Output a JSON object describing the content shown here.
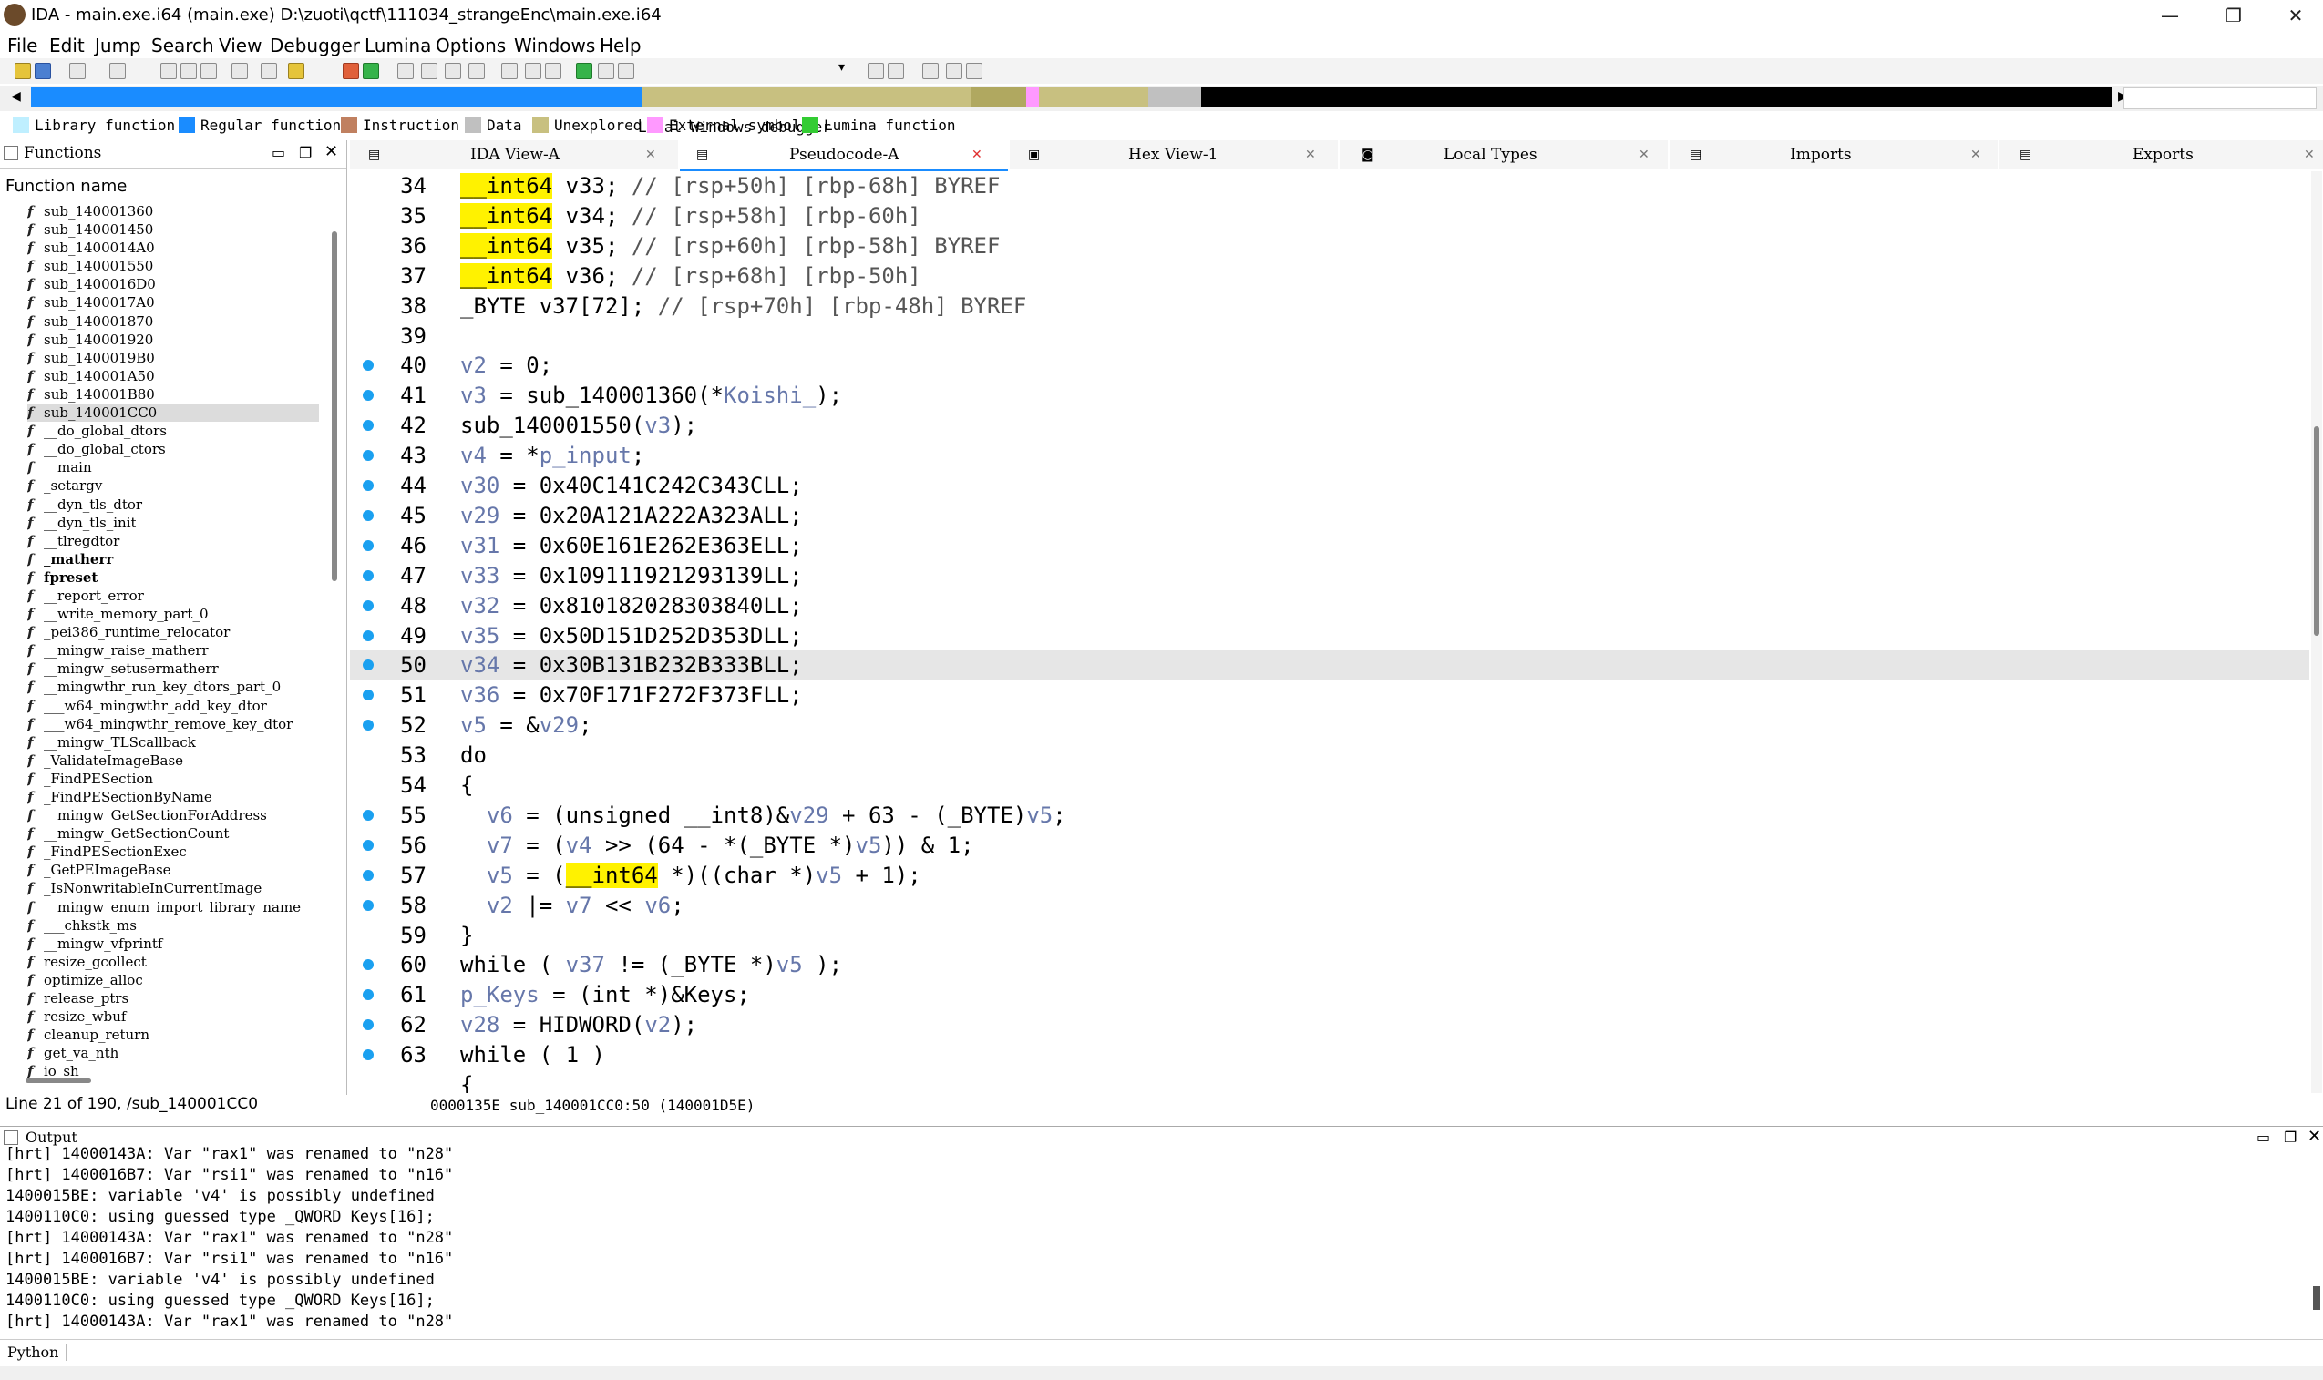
{
  "window": {
    "title": "IDA - main.exe.i64 (main.exe) D:\\zuoti\\qctf\\111034_strangeEnc\\main.exe.i64",
    "min": "—",
    "max": "❐",
    "close": "✕"
  },
  "menu": [
    "File",
    "Edit",
    "Jump",
    "Search",
    "View",
    "Debugger",
    "Lumina",
    "Options",
    "Windows",
    "Help"
  ],
  "toolbar": {
    "debugger": "Local Windows debugger"
  },
  "legend": [
    {
      "label": "Library function",
      "color": "#bfefff"
    },
    {
      "label": "Regular function",
      "color": "#1a8cff"
    },
    {
      "label": "Instruction",
      "color": "#c08060"
    },
    {
      "label": "Data",
      "color": "#c0c0c0"
    },
    {
      "label": "Unexplored",
      "color": "#c8c080"
    },
    {
      "label": "External symbol",
      "color": "#ff99ff"
    },
    {
      "label": "Lumina function",
      "color": "#33cc33"
    }
  ],
  "functions": {
    "panel_title": "Functions",
    "column_header": "Function name",
    "items": [
      "sub_140001360",
      "sub_140001450",
      "sub_1400014A0",
      "sub_140001550",
      "sub_1400016D0",
      "sub_1400017A0",
      "sub_140001870",
      "sub_140001920",
      "sub_1400019B0",
      "sub_140001A50",
      "sub_140001B80",
      "sub_140001CC0",
      "__do_global_dtors",
      "__do_global_ctors",
      "__main",
      "_setargv",
      "__dyn_tls_dtor",
      "__dyn_tls_init",
      "__tlregdtor",
      "_matherr",
      "fpreset",
      "__report_error",
      "__write_memory_part_0",
      "_pei386_runtime_relocator",
      "__mingw_raise_matherr",
      "__mingw_setusermatherr",
      "__mingwthr_run_key_dtors_part_0",
      "___w64_mingwthr_add_key_dtor",
      "___w64_mingwthr_remove_key_dtor",
      "__mingw_TLScallback",
      "_ValidateImageBase",
      "_FindPESection",
      "_FindPESectionByName",
      "__mingw_GetSectionForAddress",
      "__mingw_GetSectionCount",
      "_FindPESectionExec",
      "_GetPEImageBase",
      "_IsNonwritableInCurrentImage",
      "__mingw_enum_import_library_name",
      "___chkstk_ms",
      "__mingw_vfprintf",
      "resize_gcollect",
      "optimize_alloc",
      "release_ptrs",
      "resize_wbuf",
      "cleanup_return",
      "get_va_nth",
      "io_sh"
    ],
    "selected": "sub_140001CC0",
    "bold_items": [
      "_matherr",
      "fpreset"
    ],
    "status": "Line 21 of 190, /sub_140001CC0"
  },
  "tabs": [
    "IDA View-A",
    "Pseudocode-A",
    "Hex View-1",
    "Local Types",
    "Imports",
    "Exports"
  ],
  "code": {
    "lines": [
      {
        "n": "34",
        "dot": false,
        "t": "<span class='kw'>__int64</span> v33; <span class='cm'>// [rsp+50h] [rbp-68h] BYREF</span>"
      },
      {
        "n": "35",
        "dot": false,
        "t": "<span class='kw'>__int64</span> v34; <span class='cm'>// [rsp+58h] [rbp-60h]</span>"
      },
      {
        "n": "36",
        "dot": false,
        "t": "<span class='kw'>__int64</span> v35; <span class='cm'>// [rsp+60h] [rbp-58h] BYREF</span>"
      },
      {
        "n": "37",
        "dot": false,
        "t": "<span class='kw'>__int64</span> v36; <span class='cm'>// [rsp+68h] [rbp-50h]</span>"
      },
      {
        "n": "38",
        "dot": false,
        "t": "_BYTE v37[72]; <span class='cm'>// [rsp+70h] [rbp-48h] BYREF</span>"
      },
      {
        "n": "39",
        "dot": false,
        "t": ""
      },
      {
        "n": "40",
        "dot": true,
        "t": "<span class='var'>v2</span> = 0;"
      },
      {
        "n": "41",
        "dot": true,
        "t": "<span class='var'>v3</span> = sub_140001360(*<span class='var'>Koishi_</span>);"
      },
      {
        "n": "42",
        "dot": true,
        "t": "sub_140001550(<span class='var'>v3</span>);"
      },
      {
        "n": "43",
        "dot": true,
        "t": "<span class='var'>v4</span> = *<span class='var'>p_input</span>;"
      },
      {
        "n": "44",
        "dot": true,
        "t": "<span class='var'>v30</span> = 0x40C141C242C343CLL;"
      },
      {
        "n": "45",
        "dot": true,
        "t": "<span class='var'>v29</span> = 0x20A121A222A323ALL;"
      },
      {
        "n": "46",
        "dot": true,
        "t": "<span class='var'>v31</span> = 0x60E161E262E363ELL;"
      },
      {
        "n": "47",
        "dot": true,
        "t": "<span class='var'>v33</span> = 0x109111921293139LL;"
      },
      {
        "n": "48",
        "dot": true,
        "t": "<span class='var'>v32</span> = 0x810182028303840LL;"
      },
      {
        "n": "49",
        "dot": true,
        "t": "<span class='var'>v35</span> = 0x50D151D252D353DLL;"
      },
      {
        "n": "50",
        "dot": true,
        "t": "<span class='var'>v34</span> = 0x30B131B232B333BLL;",
        "cur": true
      },
      {
        "n": "51",
        "dot": true,
        "t": "<span class='var'>v36</span> = 0x70F171F272F373FLL;"
      },
      {
        "n": "52",
        "dot": true,
        "t": "<span class='var'>v5</span> = &amp;<span class='var'>v29</span>;"
      },
      {
        "n": "53",
        "dot": false,
        "t": "do"
      },
      {
        "n": "54",
        "dot": false,
        "t": "{"
      },
      {
        "n": "55",
        "dot": true,
        "t": "  <span class='var'>v6</span> = (unsigned __int8)&amp;<span class='var'>v29</span> + 63 - (_BYTE)<span class='var'>v5</span>;"
      },
      {
        "n": "56",
        "dot": true,
        "t": "  <span class='var'>v7</span> = (<span class='var'>v4</span> &gt;&gt; (64 - *(_BYTE *)<span class='var'>v5</span>)) &amp; 1;"
      },
      {
        "n": "57",
        "dot": true,
        "t": "  <span class='var'>v5</span> = (<span class='kw'>__int64</span> *)((char *)<span class='var'>v5</span> + 1);"
      },
      {
        "n": "58",
        "dot": true,
        "t": "  <span class='var'>v2</span> |= <span class='var'>v7</span> &lt;&lt; <span class='var'>v6</span>;"
      },
      {
        "n": "59",
        "dot": false,
        "t": "}"
      },
      {
        "n": "60",
        "dot": true,
        "t": "while ( <span class='var'>v37</span> != (_BYTE *)<span class='var'>v5</span> );"
      },
      {
        "n": "61",
        "dot": true,
        "t": "<span class='var'>p_Keys</span> = (int *)&amp;Keys;"
      },
      {
        "n": "62",
        "dot": true,
        "t": "<span class='var'>v28</span> = HIDWORD(<span class='var'>v2</span>);"
      },
      {
        "n": "63",
        "dot": true,
        "t": "while ( 1 )"
      },
      {
        "n": "",
        "dot": false,
        "t": "{"
      }
    ],
    "status": "0000135E sub_140001CC0:50 (140001D5E)"
  },
  "output": {
    "title": "Output",
    "lines": [
      "[hrt] 14000143A: Var \"rax1\" was renamed to \"n28\"",
      "[hrt] 1400016B7: Var \"rsi1\" was renamed to \"n16\"",
      "1400015BE: variable 'v4' is possibly undefined",
      "1400110C0: using guessed type _QWORD Keys[16];",
      "[hrt] 14000143A: Var \"rax1\" was renamed to \"n28\"",
      "[hrt] 1400016B7: Var \"rsi1\" was renamed to \"n16\"",
      "1400015BE: variable 'v4' is possibly undefined",
      "1400110C0: using guessed type _QWORD Keys[16];",
      "[hrt] 14000143A: Var \"rax1\" was renamed to \"n28\""
    ],
    "input_label": "Python"
  }
}
